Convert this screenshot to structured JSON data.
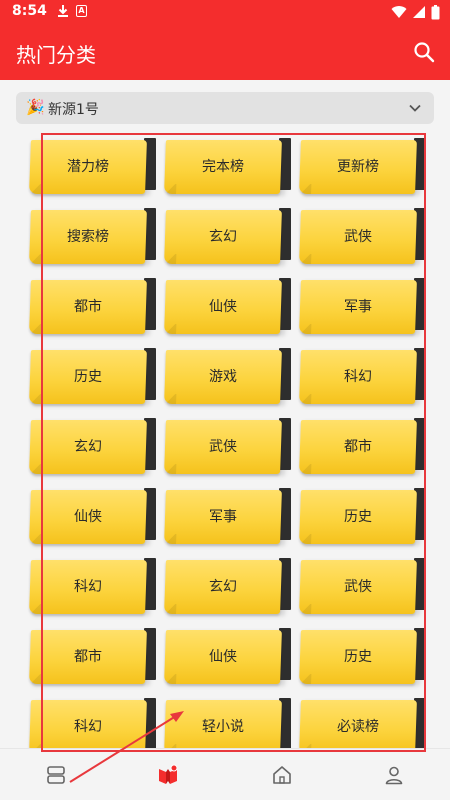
{
  "status_bar": {
    "time": "8:54",
    "a_glyph": "A"
  },
  "app_bar": {
    "title": "热门分类"
  },
  "source_select": {
    "emoji": "🎉",
    "selected": "新源1号"
  },
  "categories": [
    "潜力榜",
    "完本榜",
    "更新榜",
    "搜索榜",
    "玄幻",
    "武侠",
    "都市",
    "仙侠",
    "军事",
    "历史",
    "游戏",
    "科幻",
    "玄幻",
    "武侠",
    "都市",
    "仙侠",
    "军事",
    "历史",
    "科幻",
    "玄幻",
    "武侠",
    "都市",
    "仙侠",
    "历史",
    "科幻",
    "轻小说",
    "必读榜"
  ],
  "bottom_nav": {
    "items": [
      {
        "icon": "bookshelf-icon"
      },
      {
        "icon": "discover-icon",
        "active": true
      },
      {
        "icon": "home-icon"
      },
      {
        "icon": "profile-icon"
      }
    ]
  },
  "colors": {
    "brand": "#f42d2d",
    "annotation": "#e8383d",
    "tile": "#fcd43e"
  }
}
